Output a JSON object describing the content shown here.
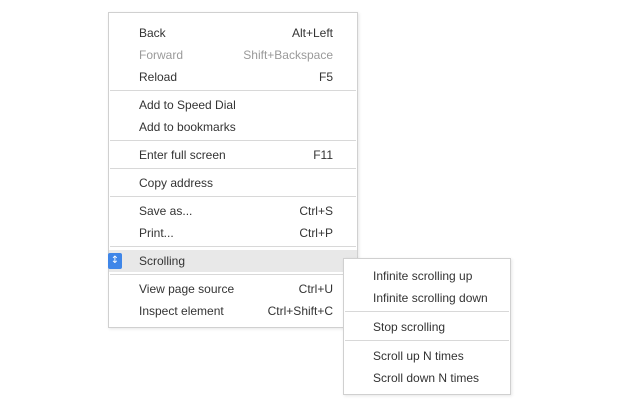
{
  "context_menu": {
    "back": {
      "label": "Back",
      "shortcut": "Alt+Left"
    },
    "forward": {
      "label": "Forward",
      "shortcut": "Shift+Backspace"
    },
    "reload": {
      "label": "Reload",
      "shortcut": "F5"
    },
    "add_speed_dial": {
      "label": "Add to Speed Dial"
    },
    "add_bookmarks": {
      "label": "Add to bookmarks"
    },
    "full_screen": {
      "label": "Enter full screen",
      "shortcut": "F11"
    },
    "copy_address": {
      "label": "Copy address"
    },
    "save_as": {
      "label": "Save as...",
      "shortcut": "Ctrl+S"
    },
    "print": {
      "label": "Print...",
      "shortcut": "Ctrl+P"
    },
    "scrolling": {
      "label": "Scrolling",
      "icon": "extension-icon",
      "chevron": "chevron-right-icon"
    },
    "view_source": {
      "label": "View page source",
      "shortcut": "Ctrl+U"
    },
    "inspect": {
      "label": "Inspect element",
      "shortcut": "Ctrl+Shift+C"
    }
  },
  "submenu": {
    "infinite_up": {
      "label": "Infinite scrolling up"
    },
    "infinite_down": {
      "label": "Infinite scrolling down"
    },
    "stop": {
      "label": "Stop scrolling"
    },
    "scroll_up_n": {
      "label": "Scroll up N times"
    },
    "scroll_down_n": {
      "label": "Scroll down N times"
    }
  },
  "colors": {
    "highlight": "#e8e8e8",
    "text": "#333333",
    "disabled_text": "#9a9a9a",
    "icon_blue": "#3f86e8"
  }
}
